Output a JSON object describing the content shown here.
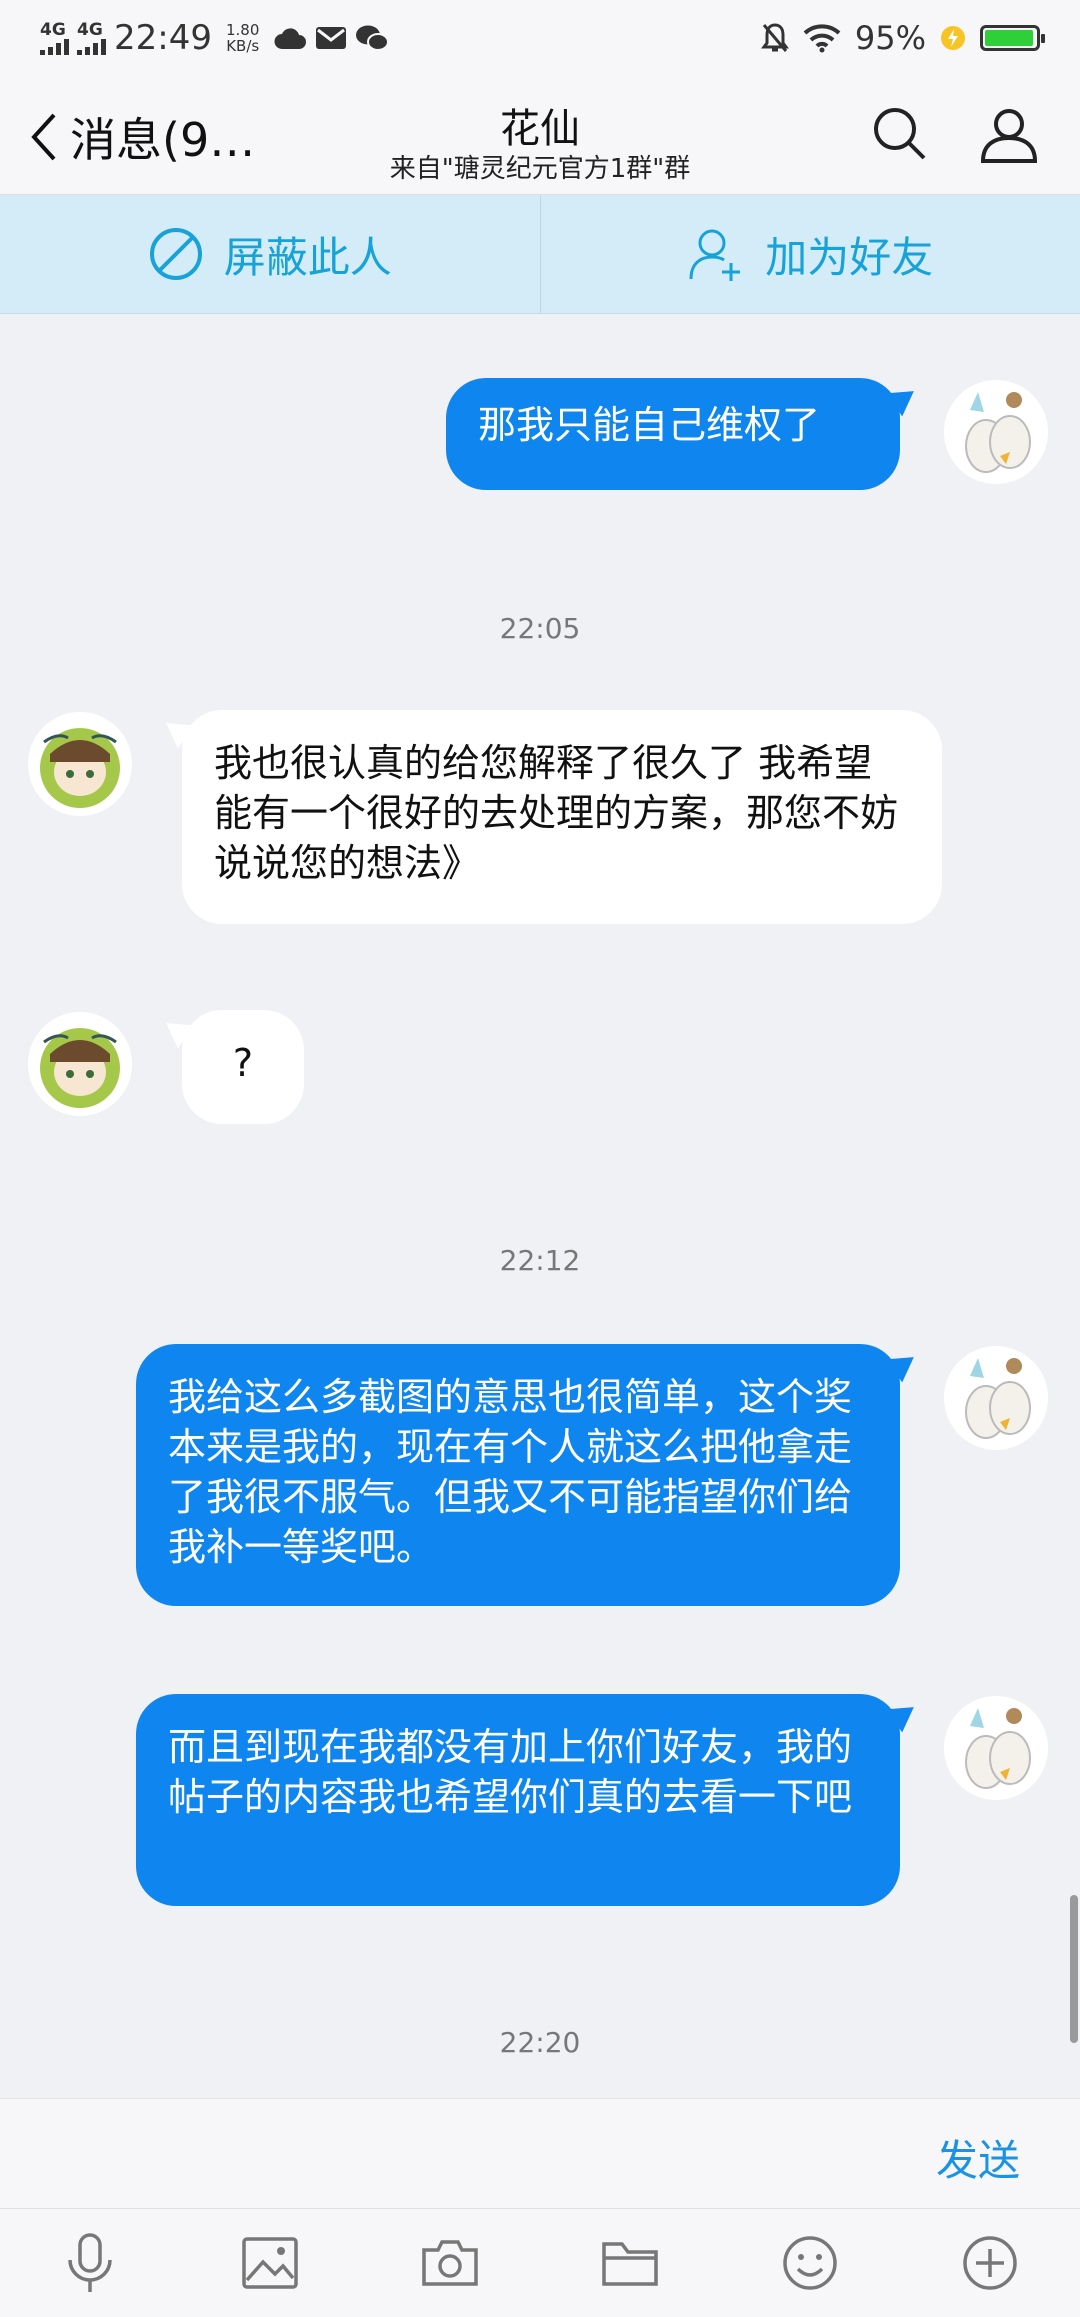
{
  "status_bar": {
    "network_1": "4G",
    "network_2": "4G",
    "time": "22:49",
    "speed_value": "1.80",
    "speed_unit": "KB/s",
    "battery": "95%"
  },
  "header": {
    "back_label": "消息(9…",
    "title": "花仙",
    "subtitle": "来自\"瑭灵纪元官方1群\"群"
  },
  "actions": {
    "block": "屏蔽此人",
    "add_friend": "加为好友"
  },
  "messages": [
    {
      "type": "out",
      "text": "那我只能自己维权了"
    },
    {
      "type": "time",
      "text": "22:05"
    },
    {
      "type": "in",
      "text": "我也很认真的给您解释了很久了  我希望能有一个很好的去处理的方案，那您不妨说说您的想法》"
    },
    {
      "type": "in",
      "text": "?"
    },
    {
      "type": "time",
      "text": "22:12"
    },
    {
      "type": "out",
      "text": "我给这么多截图的意思也很简单，这个奖本来是我的，现在有个人就这么把他拿走了我很不服气。但我又不可能指望你们给我补一等奖吧。"
    },
    {
      "type": "out",
      "text": "而且到现在我都没有加上你们好友，我的帖子的内容我也希望你们真的去看一下吧"
    },
    {
      "type": "time",
      "text": "22:20"
    }
  ],
  "composer": {
    "send_label": "发送"
  },
  "toolbar": {
    "icons": [
      "microphone-icon",
      "image-icon",
      "camera-icon",
      "folder-icon",
      "emoji-icon",
      "plus-icon"
    ]
  },
  "colors": {
    "accent": "#0f86ef",
    "action_text": "#17a2d8",
    "action_bg": "#d3ecf7"
  }
}
